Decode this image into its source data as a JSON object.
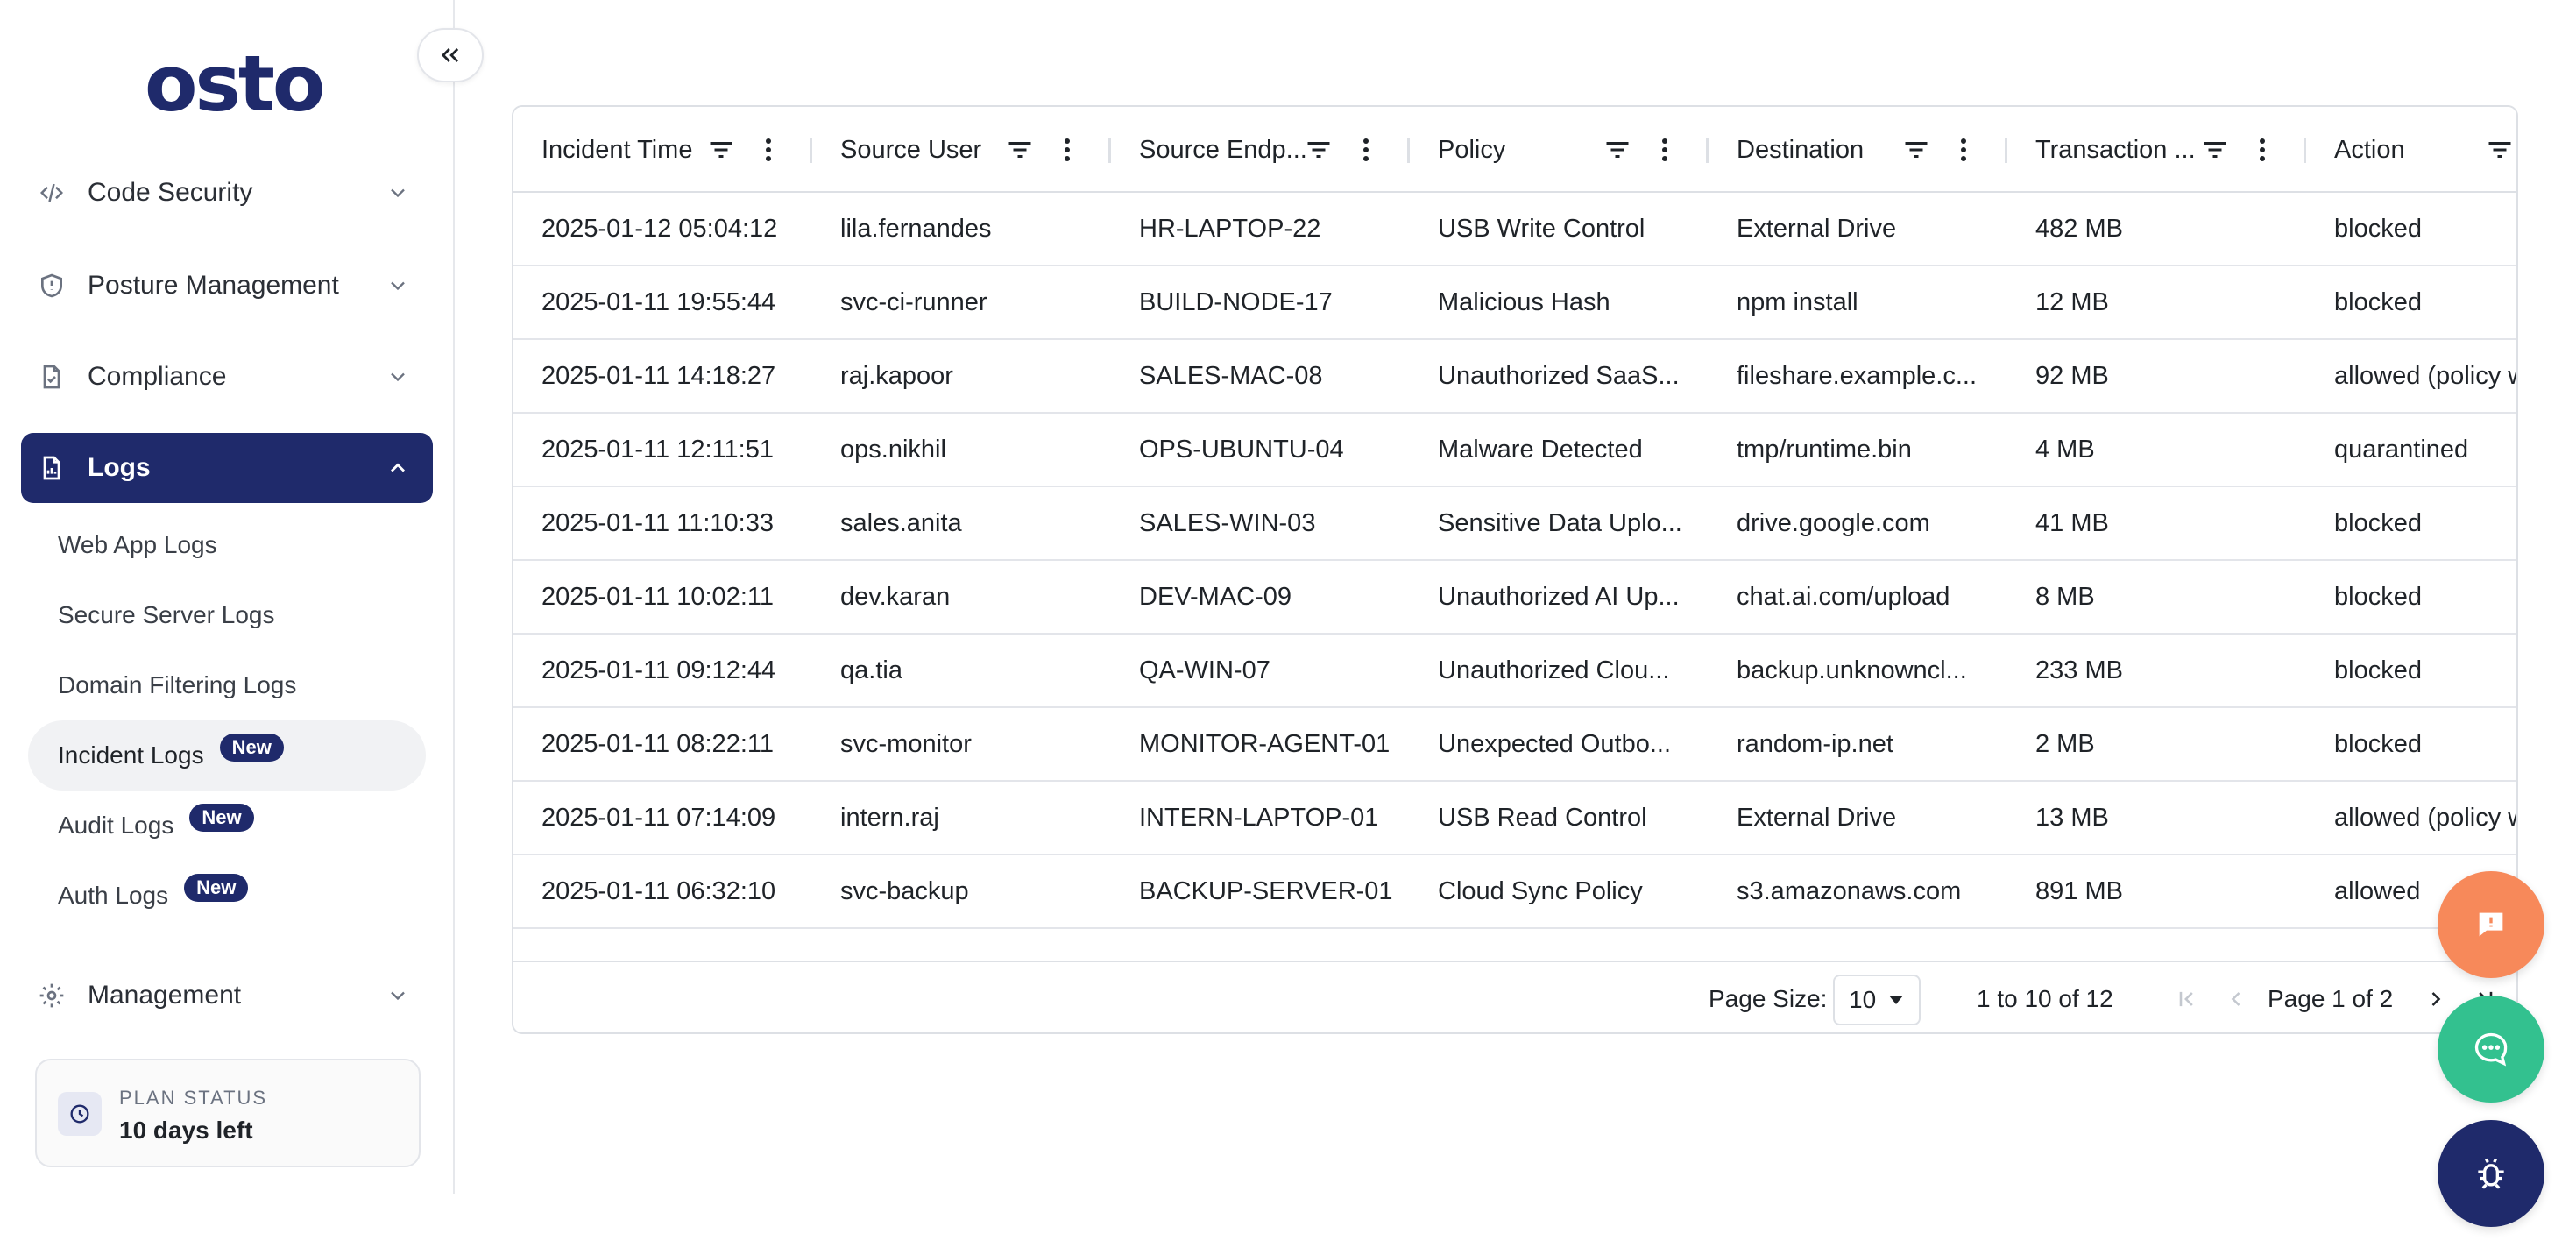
{
  "brand": {
    "logo": "osto"
  },
  "sidebar": {
    "collapse_icon": "double-chevron-left-icon",
    "items": [
      {
        "label": "Code Security",
        "icon": "code-icon"
      },
      {
        "label": "Posture Management",
        "icon": "shield-icon"
      },
      {
        "label": "Compliance",
        "icon": "document-check-icon"
      },
      {
        "label": "Logs",
        "icon": "document-chart-icon",
        "active": true
      },
      {
        "label": "Management",
        "icon": "gear-icon"
      }
    ],
    "log_links": [
      {
        "label": "Web App Logs"
      },
      {
        "label": "Secure Server Logs"
      },
      {
        "label": "Domain Filtering Logs"
      },
      {
        "label": "Incident Logs",
        "badge": "New",
        "selected": true
      },
      {
        "label": "Audit Logs",
        "badge": "New"
      },
      {
        "label": "Auth Logs",
        "badge": "New"
      }
    ],
    "plan": {
      "label": "PLAN STATUS",
      "value": "10 days left"
    }
  },
  "grid": {
    "columns": [
      "Incident Time",
      "Source User",
      "Source Endp...",
      "Policy",
      "Destination",
      "Transaction ...",
      "Action"
    ],
    "rows": [
      [
        "2025-01-12 05:04:12",
        "lila.fernandes",
        "HR-LAPTOP-22",
        "USB Write Control",
        "External Drive",
        "482 MB",
        "blocked"
      ],
      [
        "2025-01-11 19:55:44",
        "svc-ci-runner",
        "BUILD-NODE-17",
        "Malicious Hash",
        "npm install",
        "12 MB",
        "blocked"
      ],
      [
        "2025-01-11 14:18:27",
        "raj.kapoor",
        "SALES-MAC-08",
        "Unauthorized SaaS...",
        "fileshare.example.c...",
        "92 MB",
        "allowed (policy w"
      ],
      [
        "2025-01-11 12:11:51",
        "ops.nikhil",
        "OPS-UBUNTU-04",
        "Malware Detected",
        "tmp/runtime.bin",
        "4 MB",
        "quarantined"
      ],
      [
        "2025-01-11 11:10:33",
        "sales.anita",
        "SALES-WIN-03",
        "Sensitive Data Uplo...",
        "drive.google.com",
        "41 MB",
        "blocked"
      ],
      [
        "2025-01-11 10:02:11",
        "dev.karan",
        "DEV-MAC-09",
        "Unauthorized AI Up...",
        "chat.ai.com/upload",
        "8 MB",
        "blocked"
      ],
      [
        "2025-01-11 09:12:44",
        "qa.tia",
        "QA-WIN-07",
        "Unauthorized Clou...",
        "backup.unknowncl...",
        "233 MB",
        "blocked"
      ],
      [
        "2025-01-11 08:22:11",
        "svc-monitor",
        "MONITOR-AGENT-01",
        "Unexpected Outbo...",
        "random-ip.net",
        "2 MB",
        "blocked"
      ],
      [
        "2025-01-11 07:14:09",
        "intern.raj",
        "INTERN-LAPTOP-01",
        "USB Read Control",
        "External Drive",
        "13 MB",
        "allowed (policy w"
      ],
      [
        "2025-01-11 06:32:10",
        "svc-backup",
        "BACKUP-SERVER-01",
        "Cloud Sync Policy",
        "s3.amazonaws.com",
        "891 MB",
        "allowed"
      ]
    ],
    "pager": {
      "page_size_label": "Page Size:",
      "page_size_value": "10",
      "range": "1 to 10 of 12",
      "page": "Page 1 of 2"
    }
  },
  "fabs": [
    {
      "icon": "feedback-icon",
      "color": "#f7895a"
    },
    {
      "icon": "chat-icon",
      "color": "#33c18f"
    },
    {
      "icon": "bug-icon",
      "color": "#1f2a6b"
    }
  ]
}
